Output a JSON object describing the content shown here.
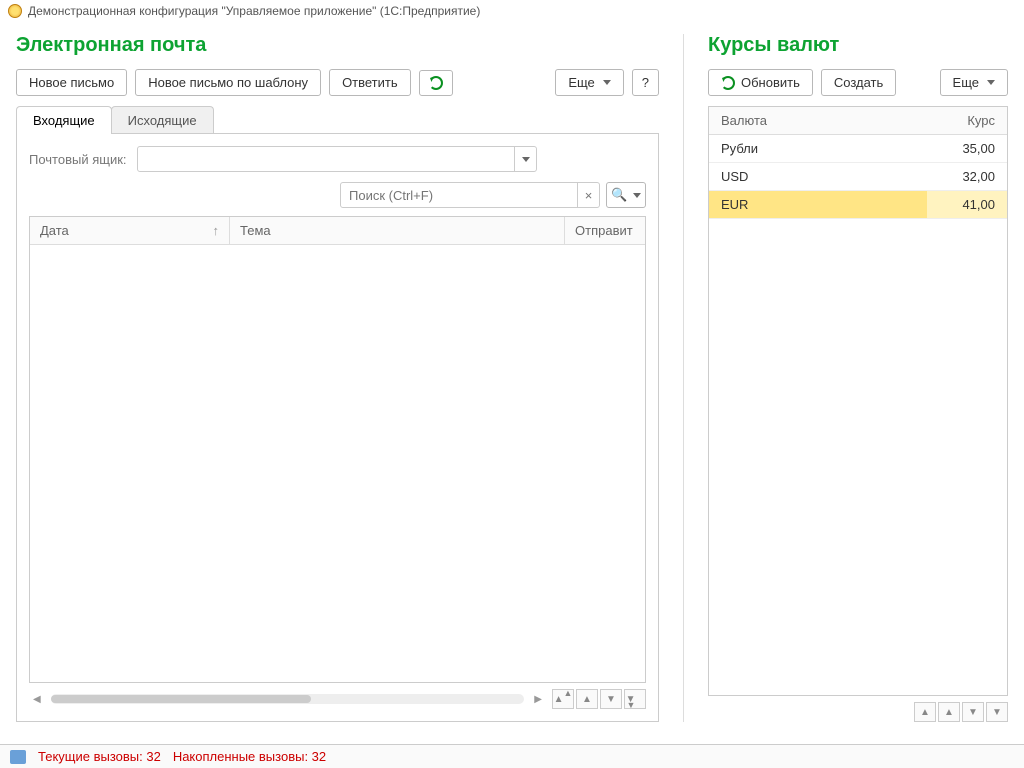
{
  "titlebar": {
    "text": "Демонстрационная конфигурация \"Управляемое приложение\"  (1С:Предприятие)"
  },
  "email": {
    "title": "Электронная почта",
    "new_letter": "Новое письмо",
    "new_by_template": "Новое письмо по шаблону",
    "reply": "Ответить",
    "more": "Еще",
    "help": "?",
    "tabs": {
      "inbox": "Входящие",
      "outbox": "Исходящие"
    },
    "mailbox_label": "Почтовый ящик:",
    "search_placeholder": "Поиск (Ctrl+F)",
    "columns": {
      "date": "Дата",
      "subject": "Тема",
      "sender": "Отправит"
    },
    "sort_indicator": "↑"
  },
  "rates": {
    "title": "Курсы валют",
    "refresh": "Обновить",
    "create": "Создать",
    "more": "Еще",
    "columns": {
      "currency": "Валюта",
      "rate": "Курс"
    },
    "rows": [
      {
        "currency": "Рубли",
        "rate": "35,00"
      },
      {
        "currency": "USD",
        "rate": "32,00"
      },
      {
        "currency": "EUR",
        "rate": "41,00"
      }
    ],
    "selected_index": 2
  },
  "status": {
    "current_calls": "Текущие вызовы: 32",
    "accumulated_calls": "Накопленные вызовы: 32"
  }
}
